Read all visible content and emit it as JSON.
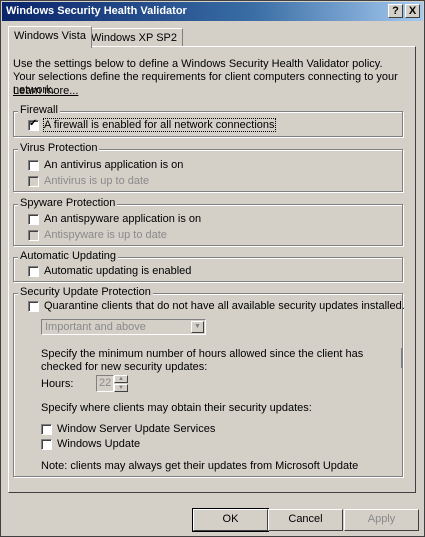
{
  "window": {
    "title": "Windows Security Health Validator",
    "help_glyph": "?",
    "close_glyph": "X"
  },
  "tabs": [
    {
      "label": "Windows Vista",
      "active": true
    },
    {
      "label": "Windows XP SP2",
      "active": false
    }
  ],
  "description": "Use the settings below to define a Windows Security Health Validator policy. Your selections define the requirements for client computers connecting to your network.",
  "learn_more": "Learn more...",
  "groups": {
    "firewall": {
      "title": "Firewall",
      "items": [
        {
          "label": "A firewall is enabled for all network connections",
          "checked": true,
          "enabled": true
        }
      ]
    },
    "virus": {
      "title": "Virus Protection",
      "items": [
        {
          "label": "An antivirus application is on",
          "checked": false,
          "enabled": true
        },
        {
          "label": "Antivirus is up to date",
          "checked": false,
          "enabled": false
        }
      ]
    },
    "spyware": {
      "title": "Spyware Protection",
      "items": [
        {
          "label": "An antispyware application is on",
          "checked": false,
          "enabled": true
        },
        {
          "label": "Antispyware is up to date",
          "checked": false,
          "enabled": false
        }
      ]
    },
    "updating": {
      "title": "Automatic Updating",
      "items": [
        {
          "label": "Automatic updating is enabled",
          "checked": false,
          "enabled": true
        }
      ]
    },
    "security_update": {
      "title": "Security Update Protection",
      "quarantine_label": "Quarantine clients that do not have all available security updates installed.",
      "severity_select": "Important and above",
      "hours_text": "Specify the minimum number of hours allowed since the client has checked for new security updates:",
      "hours_label": "Hours:",
      "hours_value": "22",
      "sources_text": "Specify where clients may obtain their security updates:",
      "sources": [
        {
          "label": "Window Server Update Services",
          "checked": false
        },
        {
          "label": "Windows Update",
          "checked": false
        }
      ],
      "note": "Note: clients may always get their updates from Microsoft Update"
    }
  },
  "buttons": {
    "ok": "OK",
    "cancel": "Cancel",
    "apply": "Apply"
  },
  "icons": {
    "help": "help-icon",
    "close": "close-icon",
    "checkmark": "checkmark-icon",
    "dropdown": "chevron-down-icon",
    "spin_up": "chevron-up-icon",
    "spin_down": "chevron-down-icon"
  },
  "colors": {
    "titlebar_start": "#0a246a",
    "titlebar_end": "#a6caf0",
    "face": "#d4d0c8",
    "disabled_text": "#8a8a8a"
  }
}
